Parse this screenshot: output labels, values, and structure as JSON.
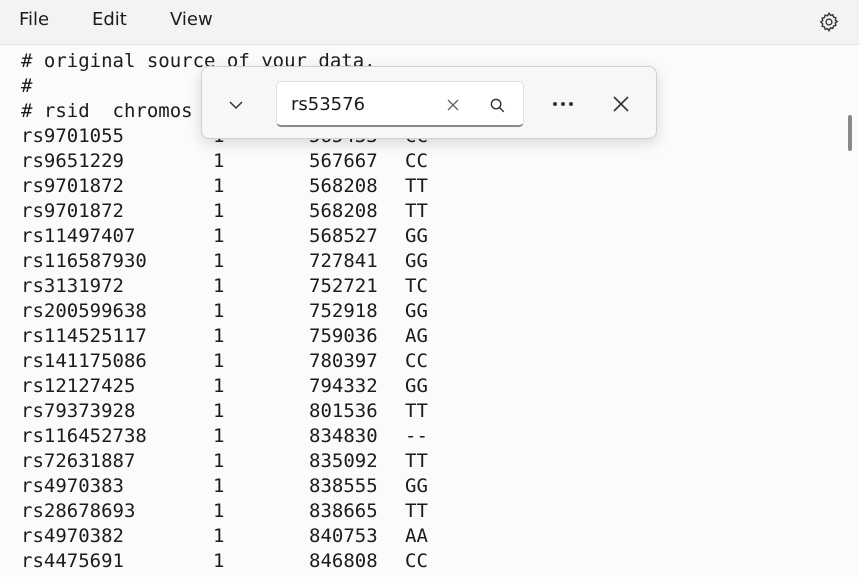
{
  "menu": {
    "file": "File",
    "edit": "Edit",
    "view": "View"
  },
  "icons": {
    "settings": "gear-icon",
    "expand": "chevron-down-icon",
    "clear": "close-icon",
    "search": "search-icon",
    "more": "more-icon",
    "close": "close-icon"
  },
  "editor": {
    "header_lines": [
      "# original source of your data.",
      "#",
      "# rsid  chromos"
    ],
    "rows": [
      {
        "rsid": "rs9701055",
        "chr": "1",
        "pos": "565433",
        "gt": "CC"
      },
      {
        "rsid": "rs9651229",
        "chr": "1",
        "pos": "567667",
        "gt": "CC"
      },
      {
        "rsid": "rs9701872",
        "chr": "1",
        "pos": "568208",
        "gt": "TT"
      },
      {
        "rsid": "rs9701872",
        "chr": "1",
        "pos": "568208",
        "gt": "TT"
      },
      {
        "rsid": "rs11497407",
        "chr": "1",
        "pos": "568527",
        "gt": "GG"
      },
      {
        "rsid": "rs116587930",
        "chr": "1",
        "pos": "727841",
        "gt": "GG"
      },
      {
        "rsid": "rs3131972",
        "chr": "1",
        "pos": "752721",
        "gt": "TC"
      },
      {
        "rsid": "rs200599638",
        "chr": "1",
        "pos": "752918",
        "gt": "GG"
      },
      {
        "rsid": "rs114525117",
        "chr": "1",
        "pos": "759036",
        "gt": "AG"
      },
      {
        "rsid": "rs141175086",
        "chr": "1",
        "pos": "780397",
        "gt": "CC"
      },
      {
        "rsid": "rs12127425",
        "chr": "1",
        "pos": "794332",
        "gt": "GG"
      },
      {
        "rsid": "rs79373928",
        "chr": "1",
        "pos": "801536",
        "gt": "TT"
      },
      {
        "rsid": "rs116452738",
        "chr": "1",
        "pos": "834830",
        "gt": "--"
      },
      {
        "rsid": "rs72631887",
        "chr": "1",
        "pos": "835092",
        "gt": "TT"
      },
      {
        "rsid": "rs4970383",
        "chr": "1",
        "pos": "838555",
        "gt": "GG"
      },
      {
        "rsid": "rs28678693",
        "chr": "1",
        "pos": "838665",
        "gt": "TT"
      },
      {
        "rsid": "rs4970382",
        "chr": "1",
        "pos": "840753",
        "gt": "AA"
      },
      {
        "rsid": "rs4475691",
        "chr": "1",
        "pos": "846808",
        "gt": "CC"
      }
    ]
  },
  "find": {
    "value": "rs53576"
  }
}
